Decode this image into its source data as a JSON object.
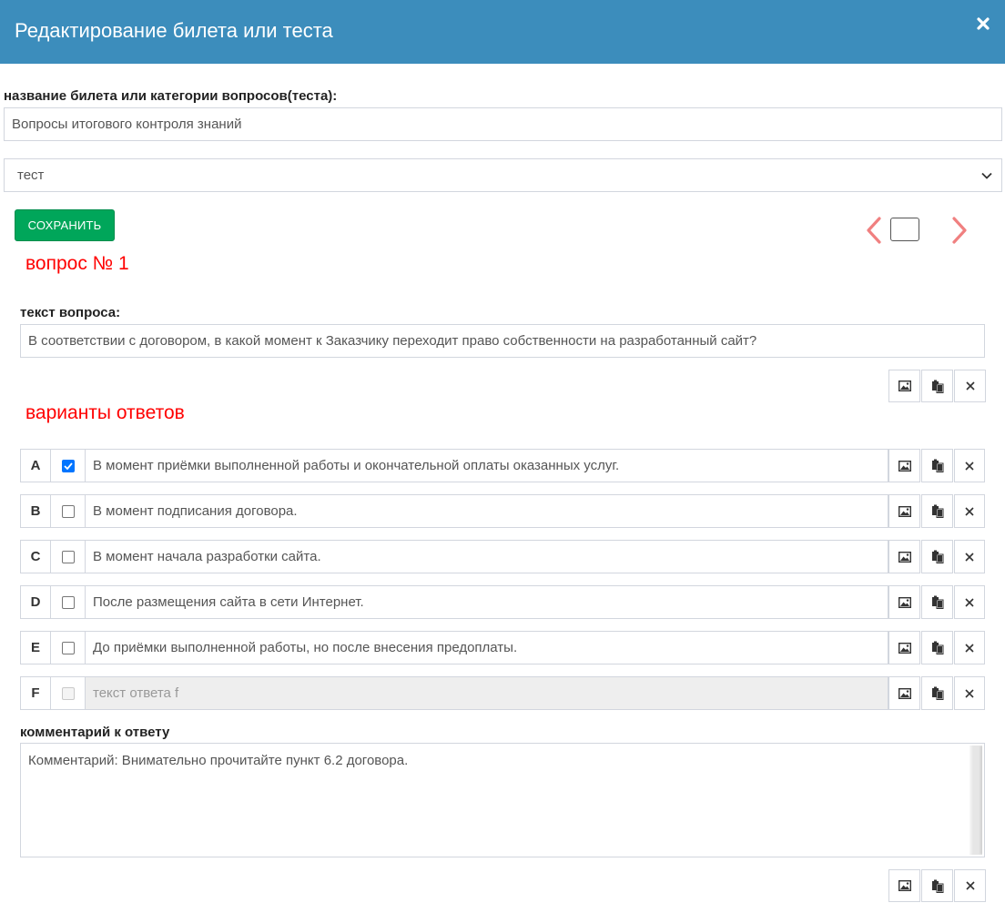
{
  "dialog": {
    "title": "Редактирование билета или теста",
    "close_icon": "close-icon",
    "header_color": "#3c8dbc"
  },
  "form": {
    "name_label": "название билета или категории вопросов(теста):",
    "name_value": "Вопросы итогового контроля знаний",
    "type_value": "тест",
    "save_label": "СОХРАНИТЬ"
  },
  "question": {
    "heading": "вопрос № 1",
    "text_label": "текст вопроса:",
    "text_value": "В соответствии с договором, в какой момент к Заказчику переходит право собственности на разработанный сайт?"
  },
  "answers": {
    "heading": "варианты ответов",
    "items": [
      {
        "letter": "A",
        "text": "В момент приёмки выполненной работы и окончательной оплаты оказанных услуг.",
        "checked": true
      },
      {
        "letter": "B",
        "text": "В момент подписания договора.",
        "checked": false
      },
      {
        "letter": "C",
        "text": "В момент начала разработки сайта.",
        "checked": false
      },
      {
        "letter": "D",
        "text": "После размещения сайта в сети Интернет.",
        "checked": false
      },
      {
        "letter": "E",
        "text": "До приёмки выполненной работы, но после внесения предоплаты.",
        "checked": false
      },
      {
        "letter": "F",
        "text": "",
        "placeholder": "текст ответа f",
        "checked": false,
        "disabled": true
      }
    ]
  },
  "comment": {
    "label": "комментарий к ответу",
    "value": "Комментарий: Внимательно прочитайте пункт 6.2 договора."
  },
  "colors": {
    "heading_red": "#ff0000",
    "save_green": "#00a65a",
    "nav_arrow": "#f08080"
  }
}
